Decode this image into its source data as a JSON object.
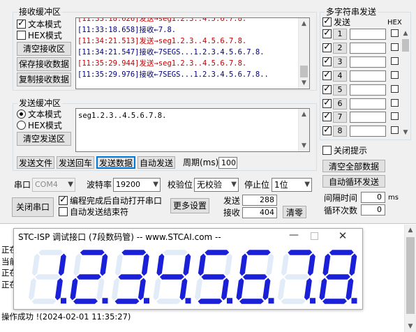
{
  "receive_group": {
    "title": "接收缓冲区",
    "text_mode_label": "文本模式",
    "text_mode_checked": true,
    "hex_mode_label": "HEX模式",
    "hex_mode_checked": false,
    "clear_button": "清空接收区",
    "save_button": "保存接收数据",
    "copy_button": "复制接收数据",
    "lines": [
      {
        "type": "send",
        "text": "[11:33:18.626]发送→seg1.2.3..4.5.6.7.8."
      },
      {
        "type": "recv",
        "text": "[11:33:18.658]接收←7.8."
      },
      {
        "type": "send",
        "text": "[11:34:21.513]发送→seg1.2.3..4.5.6.7.8."
      },
      {
        "type": "recv",
        "text": "[11:34:21.547]接收←7SEGS...1.2.3.4.5.6.7.8."
      },
      {
        "type": "send",
        "text": "[11:35:29.944]发送→seg1.2.3..4.5.6.7.8."
      },
      {
        "type": "recv",
        "text": "[11:35:29.976]接收←7SEGS...1.2.3.4.5.6.7.8.."
      }
    ]
  },
  "send_group": {
    "title": "发送缓冲区",
    "text_mode_label": "文本模式",
    "hex_mode_label": "HEX模式",
    "selected_mode": "text",
    "clear_button": "清空发送区",
    "content": "seg1.2.3..4.5.6.7.8."
  },
  "send_toolbar": {
    "send_file": "发送文件",
    "send_enter": "发送回车",
    "send_data": "发送数据",
    "auto_send": "自动发送",
    "period_label": "周期(ms)",
    "period_value": "100"
  },
  "serial": {
    "port_label": "串口",
    "port_value": "COM4",
    "baud_label": "波特率",
    "baud_value": "19200",
    "parity_label": "校验位",
    "parity_value": "无校验",
    "stopbits_label": "停止位",
    "stopbits_value": "1位",
    "close_button": "关闭串口",
    "open_after_program_label": "编程完成后自动打开串口",
    "open_after_program_checked": true,
    "auto_send_end_label": "自动发送结束符",
    "auto_send_end_checked": false,
    "more_settings": "更多设置",
    "send_count_label": "发送",
    "send_count": "288",
    "recv_count_label": "接收",
    "recv_count": "404",
    "clear_counts": "清零"
  },
  "multi_string": {
    "title": "多字符串发送",
    "send_header": "发送",
    "hex_header": "HEX",
    "rows": [
      "1",
      "2",
      "3",
      "4",
      "5",
      "6",
      "7",
      "8"
    ],
    "close_tips_label": "关闭提示",
    "clear_all_button": "清空全部数据",
    "auto_loop_button": "自动循环发送",
    "interval_label": "间隔时间",
    "interval_value": "0",
    "interval_unit": "ms",
    "loop_count_label": "循环次数",
    "loop_count_value": "0"
  },
  "log": {
    "lines": [
      "正在",
      "当前",
      "正在",
      "正在"
    ],
    "status": "操作成功 !(2024-02-01 11:35:27)"
  },
  "seg_window": {
    "title": "STC-ISP 调试接口 (7段数码管) -- www.STCAI.com --",
    "digits": [
      "1",
      "2",
      "3",
      "4",
      "5",
      "6",
      "7",
      "8"
    ],
    "digit_color": "#1a20d8",
    "off_color": "#e1ecf8"
  },
  "colors": {
    "send_text": "#c00000",
    "recv_text": "#00007f",
    "window_bg": "#f0f0f0"
  }
}
